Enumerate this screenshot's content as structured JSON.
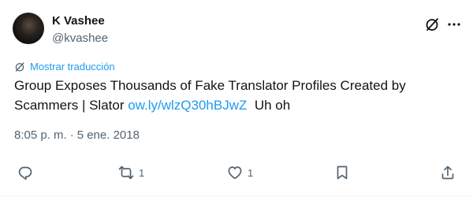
{
  "author": {
    "name": "K Vashee",
    "handle": "@kvashee"
  },
  "translate": {
    "label": "Mostrar traducción",
    "icon": "grok-translate-icon"
  },
  "tweet": {
    "text_before": "Group Exposes Thousands of Fake Translator Profiles Created by Scammers | Slator ",
    "link": "ow.ly/wlzQ30hBJwZ",
    "text_after": "  Uh oh"
  },
  "meta": {
    "time": "8:05 p. m.",
    "separator": "·",
    "date": "5 ene. 2018"
  },
  "actions": {
    "reply_count": "",
    "retweet_count": "1",
    "like_count": "1"
  },
  "colors": {
    "accent": "#1d9bf0",
    "text": "#0f1419",
    "secondary": "#536471"
  }
}
